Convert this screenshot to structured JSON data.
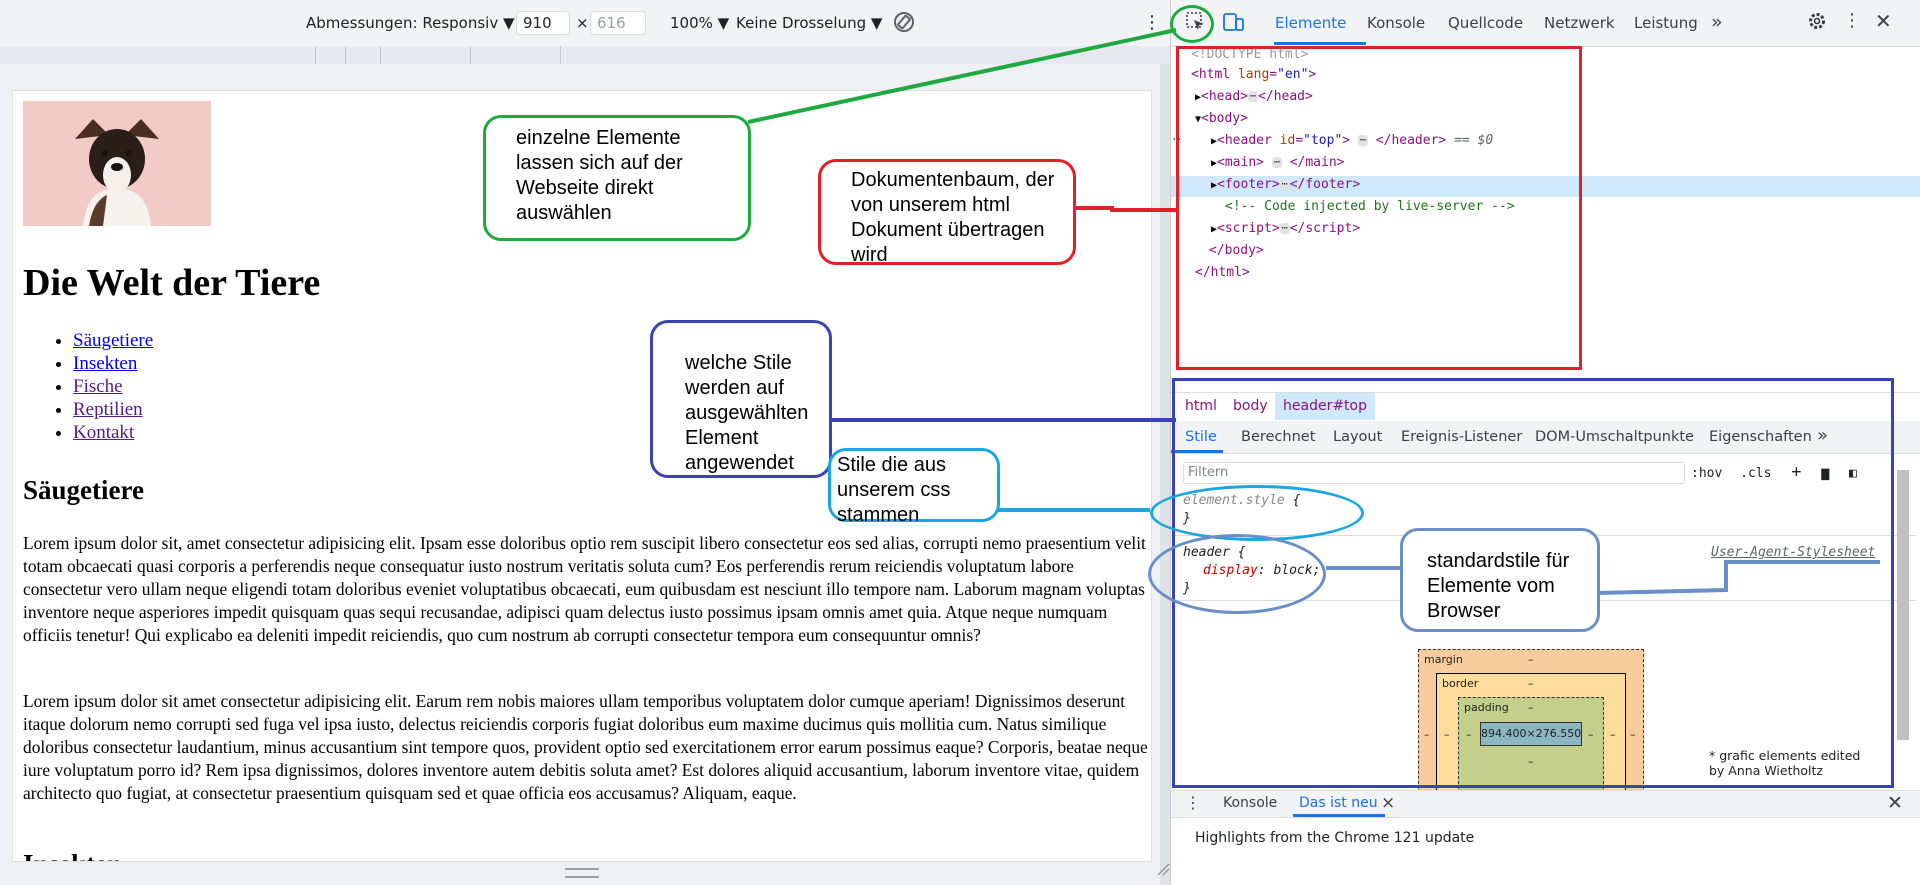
{
  "device_toolbar": {
    "dimensions_label": "Abmessungen: Responsiv",
    "width_value": "910",
    "height_value": "616",
    "times_sign": "×",
    "zoom": "100%",
    "throttle": "Keine Drosselung"
  },
  "page": {
    "title": "Die Welt der Tiere",
    "nav": [
      "Säugetiere",
      "Insekten",
      "Fische",
      "Reptilien",
      "Kontakt"
    ],
    "section1_title": "Säugetiere",
    "paragraph1": "Lorem ipsum dolor sit, amet consectetur adipisicing elit. Ipsam esse doloribus optio rem suscipit libero consectetur eos sed alias, corrupti nemo praesentium velit totam obcaecati quasi corporis a perferendis neque consequatur iusto nostrum veritatis soluta cum? Eos perferendis rerum reiciendis voluptatum labore consectetur vero ullam neque eligendi totam doloribus eveniet voluptatibus obcaecati, eum quibusdam est nesciunt illo tempore nam. Laborum magnam voluptas inventore neque asperiores impedit quisquam quas sequi recusandae, adipisci quam delectus iusto possimus ipsam omnis amet quia. Atque neque numquam officiis tenetur! Qui explicabo ea deleniti impedit reiciendis, quo cum nostrum ab corrupti consectetur tempora eum consequuntur omnis?",
    "paragraph2": "Lorem ipsum dolor sit amet consectetur adipisicing elit. Earum rem nobis maiores ullam temporibus voluptatem dolor cumque aperiam! Dignissimos deserunt itaque dolorum nemo corrupti sed fuga vel ipsa iusto, delectus reiciendis corporis fugiat doloribus eum maxime ducimus quis mollitia cum. Natus similique doloribus consectetur laudantium, minus accusantium sint tempore quos, provident optio sed exercitationem error earum possimus eaque? Corporis, beatae neque iure voluptatum porro id? Rem ipsa dignissimos, dolores inventore autem debitis soluta amet? Est dolores aliquid accusantium, laborum inventore vitae, quidem architecto quo fugiat, at consectetur praesentium quisquam sed et quae officia eos accusamus? Aliquam, eaque.",
    "section2_title": "Insekten"
  },
  "devtools": {
    "tabs": [
      "Elemente",
      "Konsole",
      "Quellcode",
      "Netzwerk",
      "Leistung"
    ],
    "more_tabs": "»",
    "tree": {
      "doctype": "<!DOCTYPE html>",
      "html_open_tag": "html",
      "html_attr": "lang",
      "html_attr_val": "\"en\"",
      "head": "head",
      "body": "body",
      "header_tag": "header",
      "header_attr": "id",
      "header_val": "\"top\"",
      "dollar0": "== $0",
      "main": "main",
      "footer": "footer",
      "comment": "<!-- Code injected by live-server -->",
      "script": "script",
      "body_close": "</body>",
      "html_close": "</html>"
    },
    "breadcrumbs": [
      "html",
      "body",
      "header#top"
    ],
    "style_tabs": [
      "Stile",
      "Berechnet",
      "Layout",
      "Ereignis-Listener",
      "DOM-Umschaltpunkte",
      "Eigenschaften"
    ],
    "filter_placeholder": "Filtern",
    "hov": ":hov",
    "cls": ".cls",
    "rule1_selector": "element.style",
    "rule2_selector": "header",
    "rule2_prop": "display",
    "rule2_val": "block;",
    "rule2_source": "User-Agent-Stylesheet",
    "box_model": {
      "margin": "margin",
      "border": "border",
      "padding": "padding",
      "dash": "–",
      "content": "894.400×276.550"
    },
    "credit": "* grafic elements edited by Anna Wietholtz",
    "drawer_tabs": [
      "Konsole",
      "Das ist neu"
    ],
    "drawer_close": "×",
    "highlight_text": "Highlights from the Chrome 121 update"
  },
  "annotations": {
    "green": "einzelne Elemente lassen sich auf der Webseite direkt auswählen",
    "red": "Dokumentenbaum, der von unserem html Dokument übertragen wird",
    "navy": "welche Stile werden auf ausgewählten Element angewendet",
    "cyan": "Stile die aus unserem css stammen",
    "steel": "standardstile für Elemente vom Browser"
  },
  "colors": {
    "green": "#1fa940",
    "red": "#e2202a",
    "navy": "#3942b8",
    "cyan": "#1aa6e2",
    "steel": "#6a8ec8",
    "accent": "#1a73e8"
  }
}
